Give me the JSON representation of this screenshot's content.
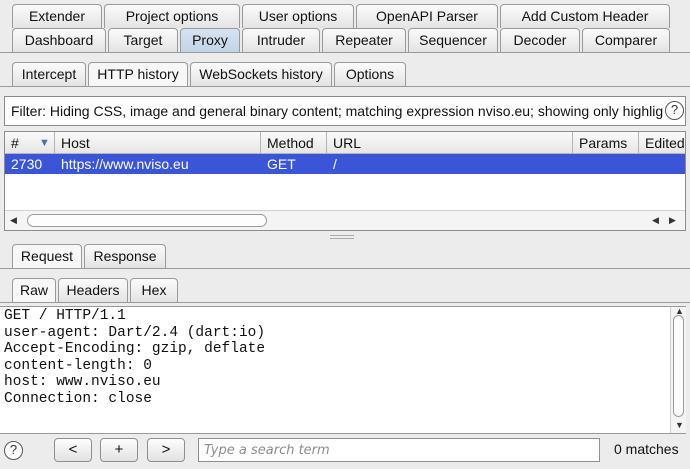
{
  "main_tabs_row1": [
    "Extender",
    "Project options",
    "User options",
    "OpenAPI Parser",
    "Add Custom Header"
  ],
  "main_tabs_row2": [
    "Dashboard",
    "Target",
    "Proxy",
    "Intruder",
    "Repeater",
    "Sequencer",
    "Decoder",
    "Comparer"
  ],
  "proxy_tabs": [
    "Intercept",
    "HTTP history",
    "WebSockets history",
    "Options"
  ],
  "filter": {
    "text": "Filter: Hiding CSS, image and general binary content;  matching expression nviso.eu;  showing only highlighted items",
    "help": "?"
  },
  "table": {
    "columns": [
      "#",
      "Host",
      "Method",
      "URL",
      "Params",
      "Edited"
    ],
    "sort_indicator": "▼",
    "rows": [
      {
        "num": "2730",
        "host": "https://www.nviso.eu",
        "method": "GET",
        "url": "/"
      }
    ]
  },
  "message_tabs": [
    "Request",
    "Response"
  ],
  "view_tabs": [
    "Raw",
    "Headers",
    "Hex"
  ],
  "request_raw": "GET / HTTP/1.1\nuser-agent: Dart/2.4 (dart:io)\nAccept-Encoding: gzip, deflate\ncontent-length: 0\nhost: www.nviso.eu\nConnection: close",
  "search": {
    "help": "?",
    "prev": "<",
    "add": "+",
    "next": ">",
    "placeholder": "Type a search term",
    "matches": "0 matches"
  },
  "colors": {
    "selected_row": "#3b55d9",
    "active_tab": "#c8d8ea"
  }
}
